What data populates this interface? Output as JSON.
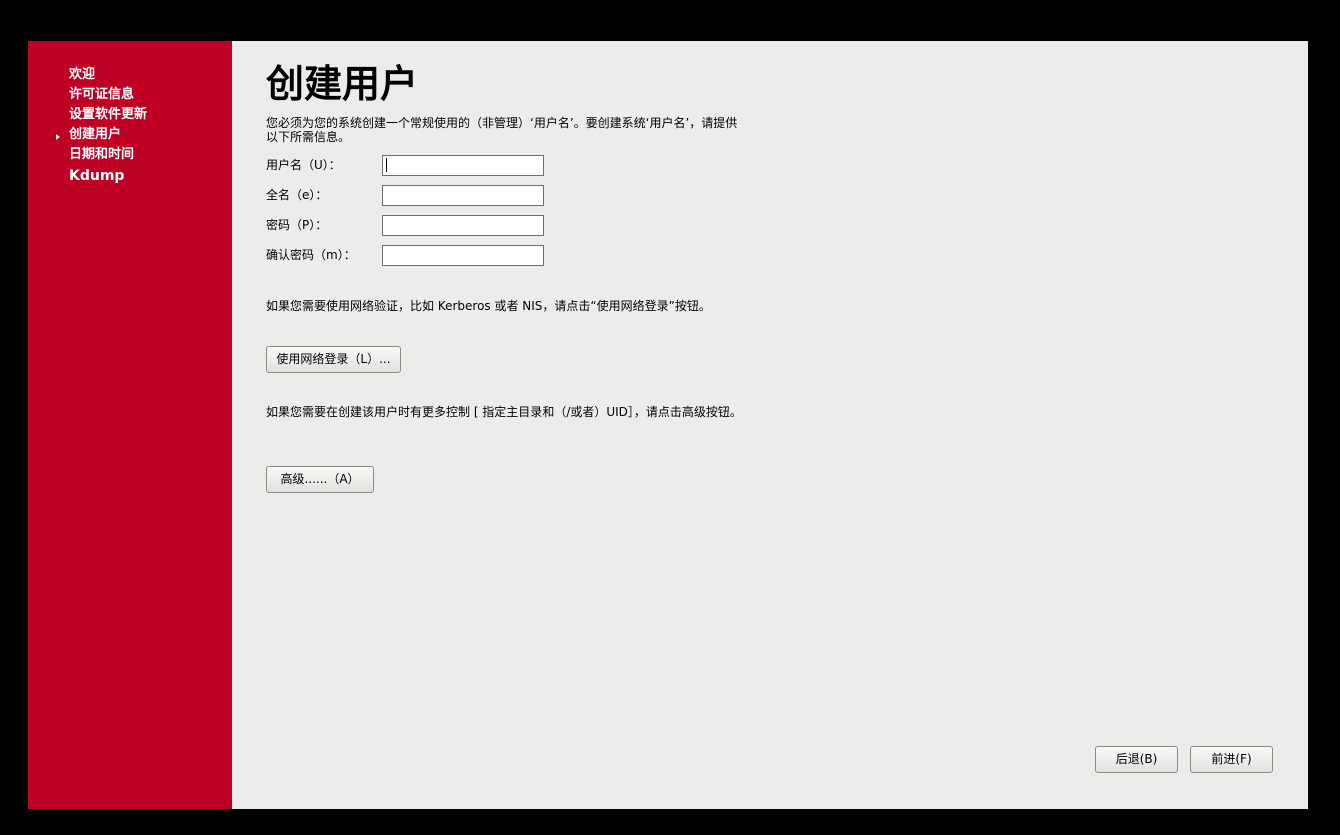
{
  "sidebar": {
    "items": [
      {
        "label": "欢迎",
        "current": false
      },
      {
        "label": "许可证信息",
        "current": false
      },
      {
        "label": "设置软件更新",
        "current": false
      },
      {
        "label": "创建用户",
        "current": true
      },
      {
        "label": "日期和时间",
        "current": false
      },
      {
        "label": "Kdump",
        "current": false
      }
    ],
    "current_marker_icon": "triangle-right-icon",
    "background_color": "#bf0024"
  },
  "page": {
    "title": "创建用户",
    "intro": "您必须为您的系统创建一个常规使用的（非管理）‘用户名’。要创建系统‘用户名’，请提供以下所需信息。"
  },
  "form": {
    "username_label": "用户名（U）：",
    "username_value": "",
    "fullname_label": "全名（e）：",
    "fullname_value": "",
    "password_label": "密码（P）：",
    "password_value": "",
    "confirm_label": "确认密码（m）：",
    "confirm_value": ""
  },
  "network": {
    "text": "如果您需要使用网络验证，比如 Kerberos 或者 NIS，请点击“使用网络登录”按钮。",
    "button_label": "使用网络登录（L）..."
  },
  "advanced": {
    "text": "如果您需要在创建该用户时有更多控制 [ 指定主目录和（/或者）UID］，请点击高级按钮。",
    "button_label": "高级......（A）"
  },
  "footer": {
    "back_label": "后退(B)",
    "forward_label": "前进(F)"
  }
}
